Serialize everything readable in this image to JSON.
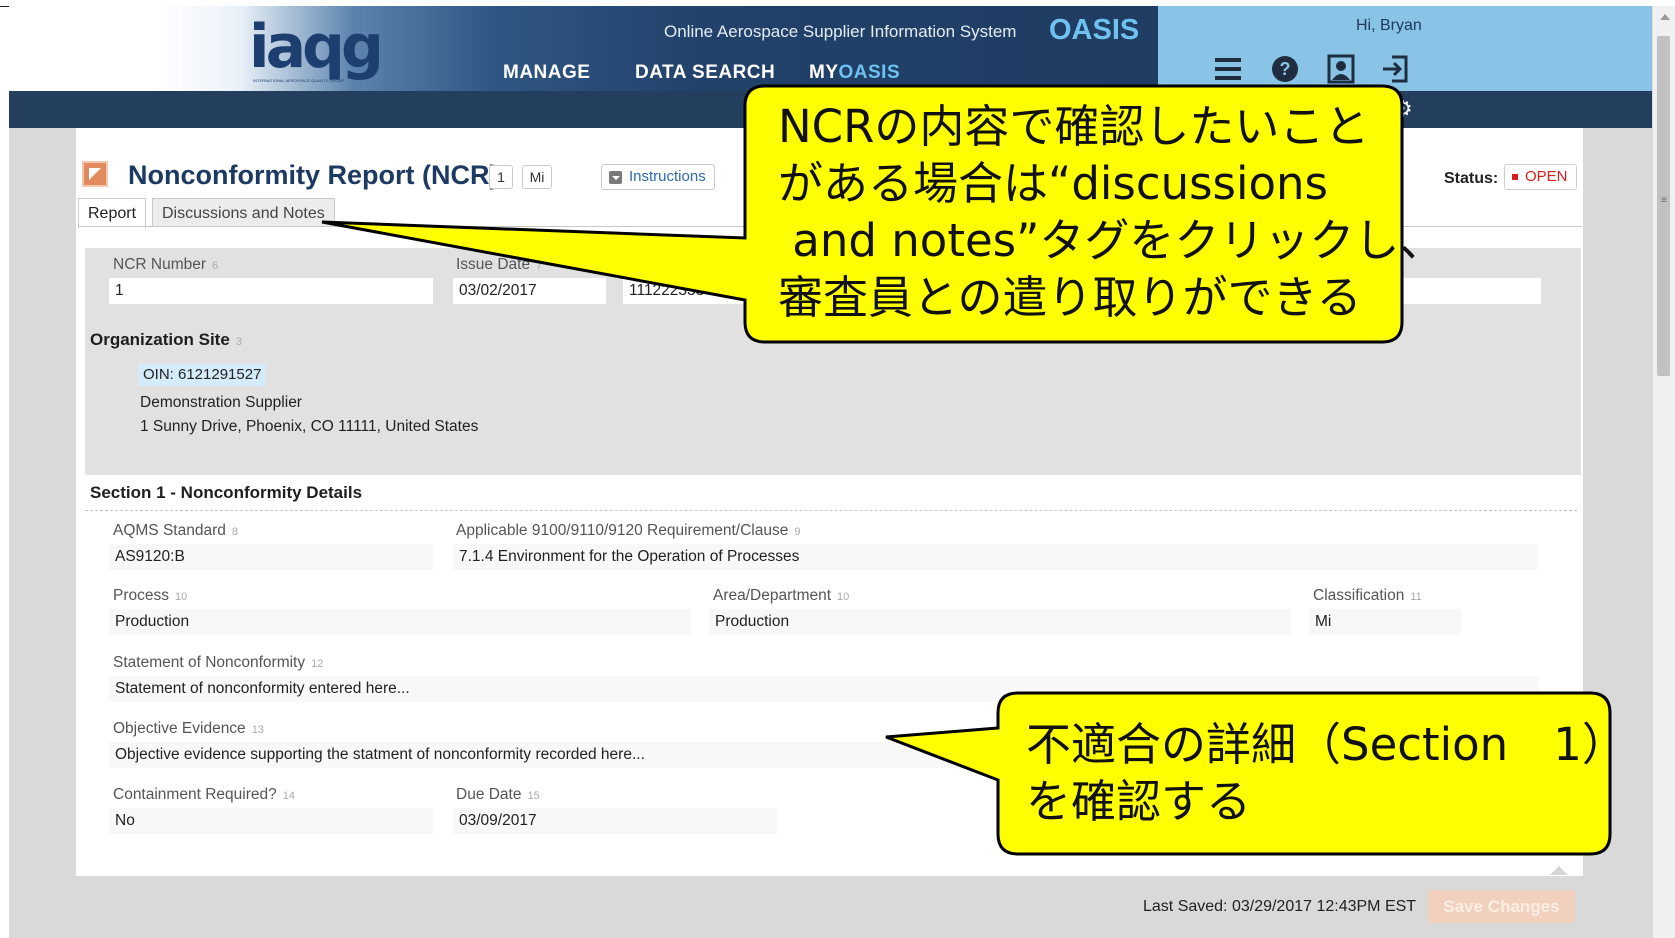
{
  "header": {
    "logo_text": "iaqg",
    "logo_subtext": "INTERNATIONAL AEROSPACE QUALITY GROUP",
    "system_subtitle": "Online Aerospace Supplier Information System",
    "system_name": "OASIS",
    "nav": [
      {
        "label": "MANAGE"
      },
      {
        "label": "DATA SEARCH"
      },
      {
        "label_prefix": "MY",
        "label_accent": "OASIS"
      }
    ],
    "greeting": "Hi, Bryan",
    "icons": [
      "menu-icon",
      "help-icon",
      "profile-icon",
      "logout-icon"
    ]
  },
  "report": {
    "title": "Nonconformity Report (NCR)",
    "count_badge": "1",
    "classification_badge": "Mi",
    "instructions_label": "Instructions",
    "status_label": "Status:",
    "status_value": "OPEN",
    "status_color": "#d41f1f",
    "tabs": [
      {
        "label": "Report",
        "active": true
      },
      {
        "label": "Discussions and Notes",
        "active": false
      }
    ]
  },
  "header_fields": {
    "ncr_number": {
      "label": "NCR Number",
      "num": "6",
      "value": "1"
    },
    "issue_date": {
      "label": "Issue Date",
      "num": "7",
      "value": "03/02/2017"
    },
    "partial_value": "111222333"
  },
  "organization": {
    "title": "Organization Site",
    "num": "3",
    "oin": "OIN: 6121291527",
    "name": "Demonstration Supplier",
    "address": "1 Sunny Drive, Phoenix, CO 11111, United States"
  },
  "section1": {
    "title": "Section 1 - Nonconformity Details",
    "aqms": {
      "label": "AQMS Standard",
      "num": "8",
      "value": "AS9120:B"
    },
    "requirement": {
      "label": "Applicable 9100/9110/9120 Requirement/Clause",
      "num": "9",
      "value": "7.1.4 Environment for the Operation of Processes"
    },
    "process": {
      "label": "Process",
      "num": "10",
      "value": "Production"
    },
    "area": {
      "label": "Area/Department",
      "num": "10",
      "value": "Production"
    },
    "classification": {
      "label": "Classification",
      "num": "11",
      "value": "Mi"
    },
    "statement": {
      "label": "Statement of Nonconformity",
      "num": "12",
      "value": "Statement of nonconformity entered here..."
    },
    "evidence": {
      "label": "Objective Evidence",
      "num": "13",
      "value": "Objective evidence supporting the statment of nonconformity recorded here..."
    },
    "containment": {
      "label": "Containment Required?",
      "num": "14",
      "value": "No"
    },
    "due_date": {
      "label": "Due Date",
      "num": "15",
      "value": "03/09/2017"
    }
  },
  "footer": {
    "last_saved": "Last Saved: 03/29/2017 12:43PM EST",
    "save_button": "Save Changes"
  },
  "callouts": {
    "top": "NCRの内容で確認したいこと\nがある場合は“discussions\n and notes”タグをクリックし、\n審査員との遣り取りができる",
    "bottom": "不適合の詳細（Section　1）\nを確認する",
    "fill_color": "#ffff00"
  }
}
